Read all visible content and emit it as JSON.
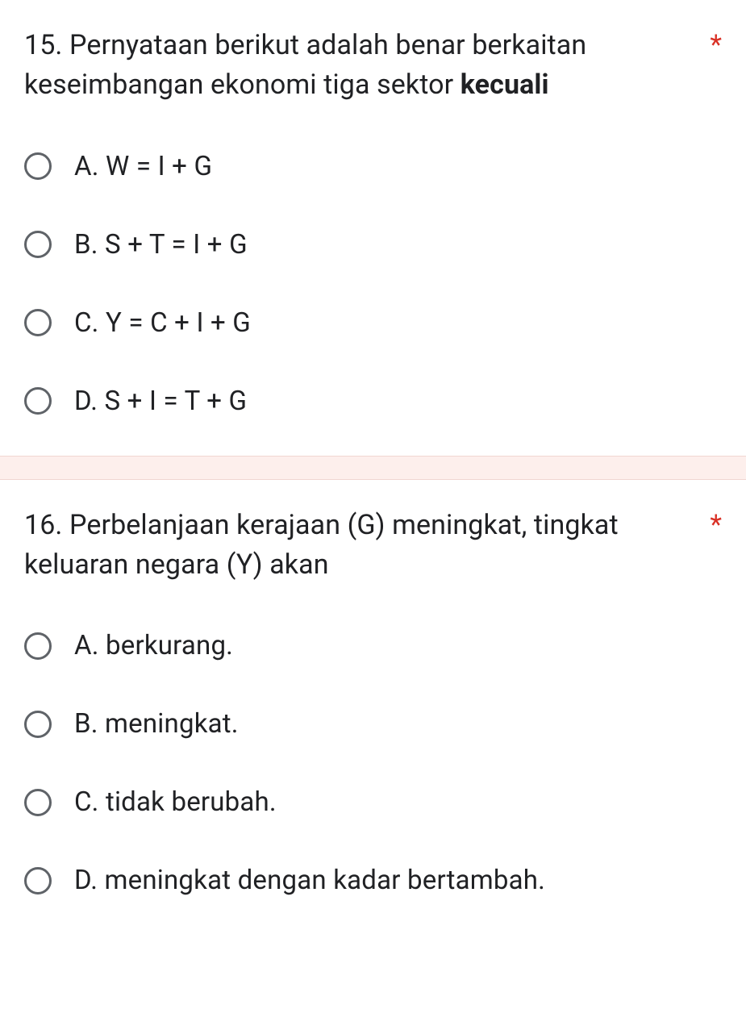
{
  "questions": [
    {
      "number": "15.",
      "text_part1": "Pernyataan berikut adalah benar berkaitan keseimbangan ekonomi tiga sektor ",
      "text_bold": "kecuali",
      "required": "*",
      "options": [
        {
          "label": "A.  W = I + G"
        },
        {
          "label": "B.  S + T = I + G"
        },
        {
          "label": "C.  Y = C + I + G"
        },
        {
          "label": "D.  S + I = T + G"
        }
      ]
    },
    {
      "number": "16.",
      "text_part1": "Perbelanjaan kerajaan (G) meningkat, tingkat keluaran negara (Y) akan",
      "text_bold": "",
      "required": "*",
      "options": [
        {
          "label": "A.  berkurang."
        },
        {
          "label": "B.  meningkat."
        },
        {
          "label": "C.  tidak berubah."
        },
        {
          "label": "D.  meningkat dengan kadar bertambah."
        }
      ]
    }
  ]
}
